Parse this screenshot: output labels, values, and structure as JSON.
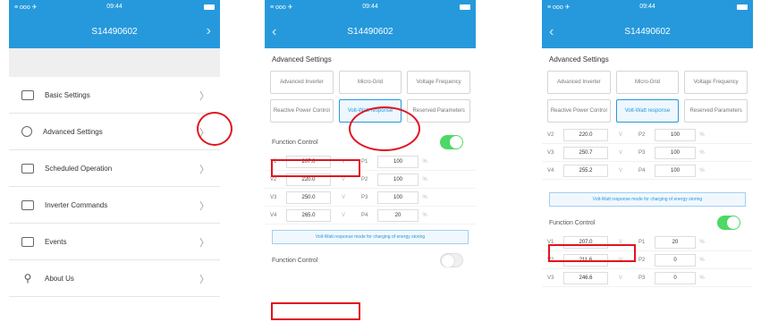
{
  "status": {
    "signal": "≡ ooo ✈",
    "time": "09:44"
  },
  "device_id": "S14490602",
  "menu": [
    {
      "label": "Basic Settings",
      "icon": "list-icon"
    },
    {
      "label": "Advanced Settings",
      "icon": "gear-icon"
    },
    {
      "label": "Scheduled Operation",
      "icon": "calendar-icon"
    },
    {
      "label": "Inverter Commands",
      "icon": "terminal-icon"
    },
    {
      "label": "Events",
      "icon": "events-icon"
    },
    {
      "label": "About Us",
      "icon": "person-icon"
    }
  ],
  "advanced": {
    "title": "Advanced Settings",
    "tabs": [
      "Advanced Inverter",
      "Micro-Grid",
      "Voltage Frequency",
      "Reactive Power Control",
      "Volt-Watt response",
      "Reserved Parameters"
    ],
    "active_tab": 4,
    "function_control": "Function Control",
    "note": "Volt-Watt response mode for charging of energy storing"
  },
  "screen2": {
    "rows": [
      {
        "vl": "V1",
        "vv": "207.0",
        "vu": "V",
        "pl": "P1",
        "pv": "100",
        "pu": "%"
      },
      {
        "vl": "V2",
        "vv": "220.0",
        "vu": "V",
        "pl": "P2",
        "pv": "100",
        "pu": "%"
      },
      {
        "vl": "V3",
        "vv": "250.0",
        "vu": "V",
        "pl": "P3",
        "pv": "100",
        "pu": "%"
      },
      {
        "vl": "V4",
        "vv": "265.0",
        "vu": "V",
        "pl": "P4",
        "pv": "20",
        "pu": "%"
      }
    ]
  },
  "screen3": {
    "top_rows": [
      {
        "vl": "V2",
        "vv": "220.0",
        "vu": "V",
        "pl": "P2",
        "pv": "100",
        "pu": "%"
      },
      {
        "vl": "V3",
        "vv": "250.7",
        "vu": "V",
        "pl": "P3",
        "pv": "100",
        "pu": "%"
      },
      {
        "vl": "V4",
        "vv": "255.2",
        "vu": "V",
        "pl": "P4",
        "pv": "100",
        "pu": "%"
      }
    ],
    "bottom_rows": [
      {
        "vl": "V1",
        "vv": "207.0",
        "vu": "V",
        "pl": "P1",
        "pv": "20",
        "pu": "%"
      },
      {
        "vl": "V2",
        "vv": "211.6",
        "vu": "V",
        "pl": "P2",
        "pv": "0",
        "pu": "%"
      },
      {
        "vl": "V3",
        "vv": "246.6",
        "vu": "V",
        "pl": "P3",
        "pv": "0",
        "pu": "%"
      }
    ]
  },
  "colors": {
    "header": "#2699dc",
    "toggle_on": "#4cd964",
    "annotation": "#e0141e"
  }
}
